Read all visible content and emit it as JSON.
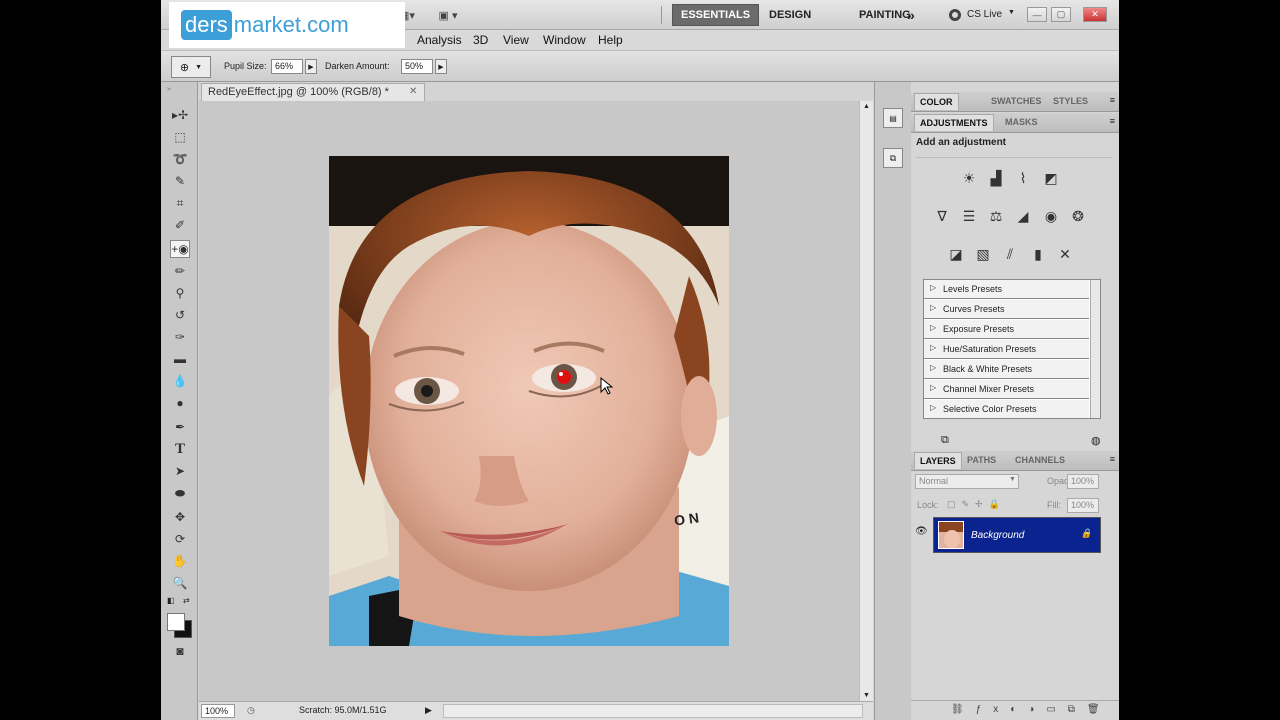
{
  "watermark": {
    "prefix": "ders",
    "suffix": "market.com"
  },
  "workspaces": {
    "essentials": "ESSENTIALS",
    "design": "DESIGN",
    "painting": "PAINTING",
    "more": "»"
  },
  "cslive": "CS Live",
  "menu": [
    "Analysis",
    "3D",
    "View",
    "Window",
    "Help"
  ],
  "options": {
    "pupil_label": "Pupil Size:",
    "pupil_value": "66%",
    "darken_label": "Darken Amount:",
    "darken_value": "50%"
  },
  "document": {
    "tab_title": "RedEyeEffect.jpg @ 100% (RGB/8) *",
    "zoom": "100%",
    "scratch": "Scratch: 95.0M/1.51G",
    "shirt_text": "O N"
  },
  "panels": {
    "tabs_top": [
      "COLOR",
      "SWATCHES",
      "STYLES"
    ],
    "tabs_adj": [
      "ADJUSTMENTS",
      "MASKS"
    ],
    "adj_heading": "Add an adjustment",
    "presets": [
      "Levels Presets",
      "Curves Presets",
      "Exposure Presets",
      "Hue/Saturation Presets",
      "Black & White Presets",
      "Channel Mixer Presets",
      "Selective Color Presets"
    ],
    "tabs_layers": [
      "LAYERS",
      "PATHS",
      "CHANNELS"
    ],
    "blend_mode": "Normal",
    "opacity_label": "Opacity:",
    "opacity_value": "100%",
    "lock_label": "Lock:",
    "fill_label": "Fill:",
    "fill_value": "100%",
    "layer_name": "Background"
  },
  "colors": {
    "accent": "#3d9fd8",
    "layer_selected": "#0a238f",
    "red_eye": "#e01010"
  }
}
